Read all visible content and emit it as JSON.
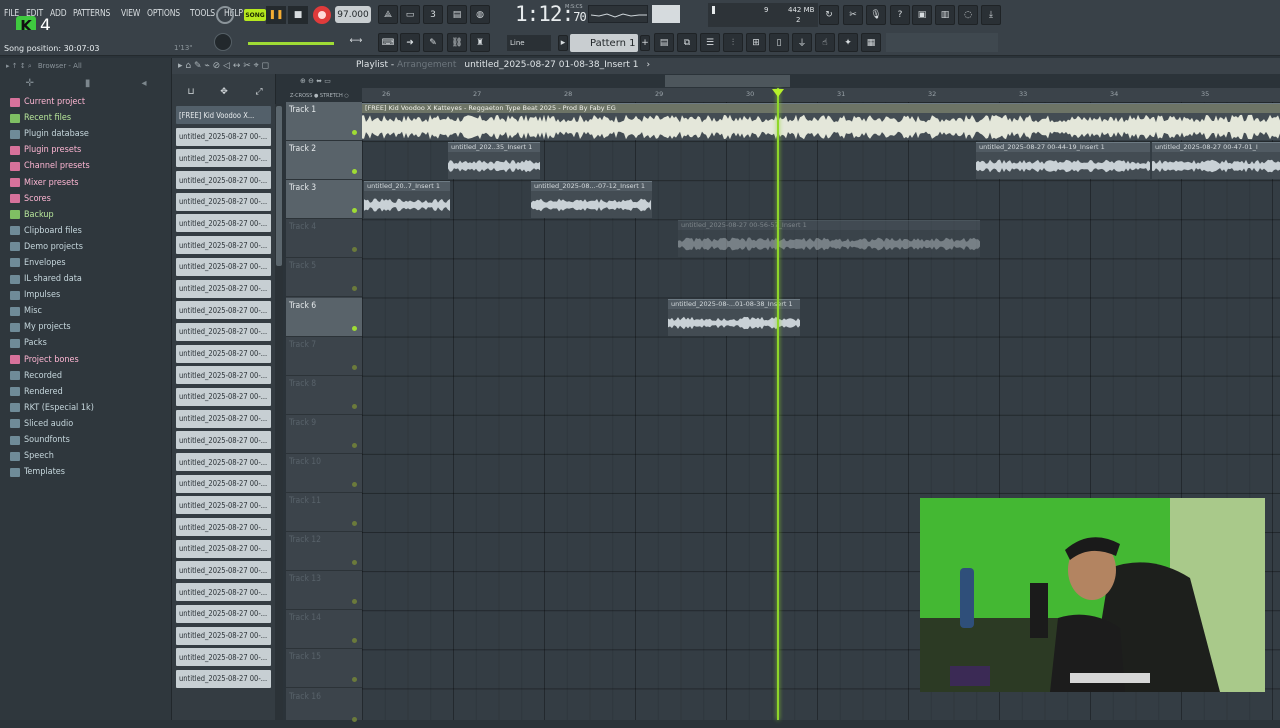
{
  "menu": [
    "FILE",
    "EDIT",
    "ADD",
    "PATTERNS",
    "VIEW",
    "OPTIONS",
    "TOOLS",
    "HELP"
  ],
  "logo": {
    "letter": "K",
    "number": "4"
  },
  "song_position": "Song position: 30:07:03",
  "small_ratio": "1'13\"",
  "transport": {
    "mode": "SONG",
    "tempo": "97.000",
    "time_main": "1:12:",
    "time_frac": "70",
    "time_unit": "M:S:CS"
  },
  "cpu": {
    "value1": "9",
    "memory": "442 MB",
    "value2": "2"
  },
  "snap": "Line",
  "pattern": "Pattern 1",
  "browser": {
    "header": "Browser - All",
    "items": [
      {
        "label": "Current project",
        "style": "pink"
      },
      {
        "label": "Recent files",
        "style": "green"
      },
      {
        "label": "Plugin database",
        "style": "normal"
      },
      {
        "label": "Plugin presets",
        "style": "pink"
      },
      {
        "label": "Channel presets",
        "style": "pink"
      },
      {
        "label": "Mixer presets",
        "style": "pink"
      },
      {
        "label": "Scores",
        "style": "pink"
      },
      {
        "label": "Backup",
        "style": "green"
      },
      {
        "label": "Clipboard files",
        "style": "normal"
      },
      {
        "label": "Demo projects",
        "style": "normal"
      },
      {
        "label": "Envelopes",
        "style": "normal"
      },
      {
        "label": "IL shared data",
        "style": "normal"
      },
      {
        "label": "Impulses",
        "style": "normal"
      },
      {
        "label": "Misc",
        "style": "normal"
      },
      {
        "label": "My projects",
        "style": "normal"
      },
      {
        "label": "Packs",
        "style": "normal"
      },
      {
        "label": "Project bones",
        "style": "pink"
      },
      {
        "label": "Recorded",
        "style": "normal"
      },
      {
        "label": "Rendered",
        "style": "normal"
      },
      {
        "label": "RKT (Especial 1k)",
        "style": "normal"
      },
      {
        "label": "Sliced audio",
        "style": "normal"
      },
      {
        "label": "Soundfonts",
        "style": "normal"
      },
      {
        "label": "Speech",
        "style": "normal"
      },
      {
        "label": "Templates",
        "style": "normal"
      }
    ]
  },
  "clip_picker": [
    "[FREE] Kid Voodoo X...",
    "untitled_2025-08-27 00-...",
    "untitled_2025-08-27 00-...",
    "untitled_2025-08-27 00-...",
    "untitled_2025-08-27 00-...",
    "untitled_2025-08-27 00-...",
    "untitled_2025-08-27 00-...",
    "untitled_2025-08-27 00-...",
    "untitled_2025-08-27 00-...",
    "untitled_2025-08-27 00-...",
    "untitled_2025-08-27 00-...",
    "untitled_2025-08-27 00-...",
    "untitled_2025-08-27 00-...",
    "untitled_2025-08-27 00-...",
    "untitled_2025-08-27 00-...",
    "untitled_2025-08-27 00-...",
    "untitled_2025-08-27 00-...",
    "untitled_2025-08-27 00-...",
    "untitled_2025-08-27 00-...",
    "untitled_2025-08-27 00-...",
    "untitled_2025-08-27 00-...",
    "untitled_2025-08-27 00-...",
    "untitled_2025-08-27 00-...",
    "untitled_2025-08-27 00-...",
    "untitled_2025-08-27 00-...",
    "untitled_2025-08-27 00-...",
    "untitled_2025-08-27 00-..."
  ],
  "playlist": {
    "title": "Playlist",
    "subtitle": "Arrangement",
    "clip_name": "untitled_2025-08-27 01-08-38_Insert 1",
    "ruler_marks": [
      "26",
      "27",
      "28",
      "29",
      "30",
      "31",
      "32",
      "33",
      "34",
      "35"
    ],
    "tracks": [
      {
        "name": "Track 1",
        "active": true
      },
      {
        "name": "Track 2",
        "active": true
      },
      {
        "name": "Track 3",
        "active": true
      },
      {
        "name": "Track 4",
        "active": false
      },
      {
        "name": "Track 5",
        "active": false
      },
      {
        "name": "Track 6",
        "active": true
      },
      {
        "name": "Track 7",
        "active": false
      },
      {
        "name": "Track 8",
        "active": false
      },
      {
        "name": "Track 9",
        "active": false
      },
      {
        "name": "Track 10",
        "active": false
      },
      {
        "name": "Track 11",
        "active": false
      },
      {
        "name": "Track 12",
        "active": false
      },
      {
        "name": "Track 13",
        "active": false
      },
      {
        "name": "Track 14",
        "active": false
      },
      {
        "name": "Track 15",
        "active": false
      },
      {
        "name": "Track 16",
        "active": false
      }
    ],
    "clips": [
      {
        "label": "[FREE] Kid Voodoo X Katteyes - Reggaeton Type Beat 2025 - Prod By Faby EG",
        "track": 0,
        "start": 0,
        "end": 918,
        "dim": false,
        "big": true
      },
      {
        "label": "untitled_202..35_Insert 1",
        "track": 1,
        "start": 86,
        "end": 178,
        "dim": false,
        "big": false
      },
      {
        "label": "untitled_2025-08-27 00-44-19_Insert 1",
        "track": 1,
        "start": 614,
        "end": 788,
        "dim": false,
        "big": false
      },
      {
        "label": "untitled_2025-08-27 00-47-01_I",
        "track": 1,
        "start": 790,
        "end": 918,
        "dim": false,
        "big": false
      },
      {
        "label": "untitled_20..7_Insert 1",
        "track": 2,
        "start": 2,
        "end": 88,
        "dim": false,
        "big": false
      },
      {
        "label": "untitled_2025-08...-07-12_Insert 1",
        "track": 2,
        "start": 169,
        "end": 290,
        "dim": false,
        "big": false
      },
      {
        "label": "untitled_2025-08-27 00-56-57_Insert 1",
        "track": 3,
        "start": 316,
        "end": 618,
        "dim": true,
        "big": false
      },
      {
        "label": "untitled_2025-08-...01-08-38_Insert 1",
        "track": 5,
        "start": 306,
        "end": 438,
        "dim": false,
        "big": false
      }
    ]
  },
  "colors": {
    "accent": "#9fdc35",
    "record": "#e03b3b",
    "play": "#f5ad33"
  }
}
